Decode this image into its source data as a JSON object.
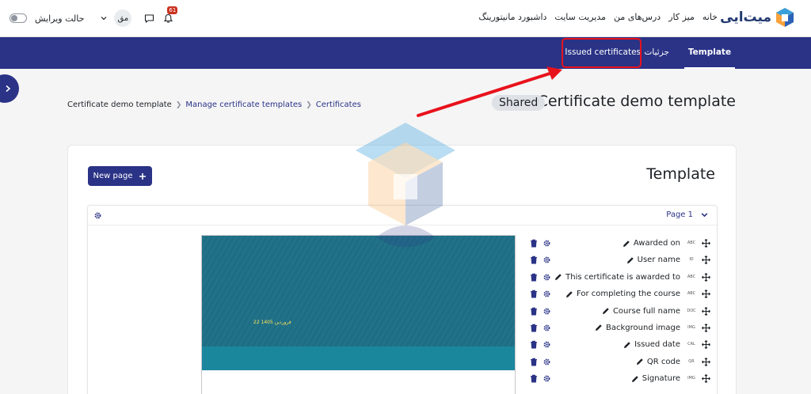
{
  "navbar": {
    "brand_name": "میت‌ایی",
    "primary_nav": [
      "خانه",
      "میز کار",
      "درس‌های من",
      "مدیریت سایت",
      "داشبورد مانیتورینگ"
    ],
    "edit_mode_label": "حالت ویرایش",
    "avatar_initials": "مق",
    "notification_count": "61"
  },
  "secondary_nav": {
    "tabs": [
      "Template",
      "جزئیات",
      "Issued certificates"
    ],
    "active_tab": "Template"
  },
  "header": {
    "title": "Certificate demo template",
    "shared_badge": "Shared",
    "breadcrumb": [
      "Certificate demo template",
      "Manage certificate templates",
      "Certificates"
    ]
  },
  "card": {
    "title": "Template",
    "new_page_label": "New page",
    "page_label": "Page 1",
    "preview_date_text": "22 فروردین 1405",
    "elements": [
      {
        "name": "Awarded on",
        "type": "ABC"
      },
      {
        "name": "User name",
        "type": "ID"
      },
      {
        "name": "This certificate is awarded to",
        "type": "ABC"
      },
      {
        "name": "For completing the course",
        "type": "ABC"
      },
      {
        "name": "Course full name",
        "type": "DOC"
      },
      {
        "name": "Background image",
        "type": "IMG"
      },
      {
        "name": "Issued date",
        "type": "CAL"
      },
      {
        "name": "QR code",
        "type": "QR"
      },
      {
        "name": "Signature",
        "type": "IMG"
      }
    ]
  },
  "colors": {
    "primary": "#2a3386",
    "highlight": "#e8121c",
    "badge": "#ca3120"
  }
}
